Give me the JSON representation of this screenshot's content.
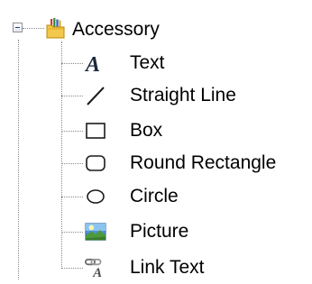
{
  "tree": {
    "node": {
      "label": "Accessory",
      "expanded": true,
      "icon": "folder-with-pencils-icon"
    },
    "items": [
      {
        "label": "Text",
        "icon": "text-icon"
      },
      {
        "label": "Straight Line",
        "icon": "straight-line-icon"
      },
      {
        "label": "Box",
        "icon": "box-icon"
      },
      {
        "label": "Round Rectangle",
        "icon": "round-rectangle-icon"
      },
      {
        "label": "Circle",
        "icon": "circle-icon"
      },
      {
        "label": "Picture",
        "icon": "picture-icon"
      },
      {
        "label": "Link Text",
        "icon": "link-text-icon"
      }
    ]
  }
}
